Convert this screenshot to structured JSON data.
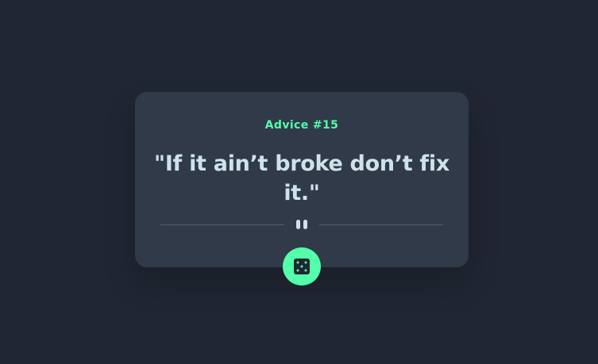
{
  "card": {
    "advice_label": "Advice #15",
    "quote": "\"If it ain’t broke don’t fix it.\""
  },
  "button": {
    "icon": "dice-icon"
  },
  "colors": {
    "background": "#202632",
    "card": "#313a48",
    "accent": "#53ffaa",
    "text": "#cee3e9",
    "divider": "#4f5d74"
  }
}
